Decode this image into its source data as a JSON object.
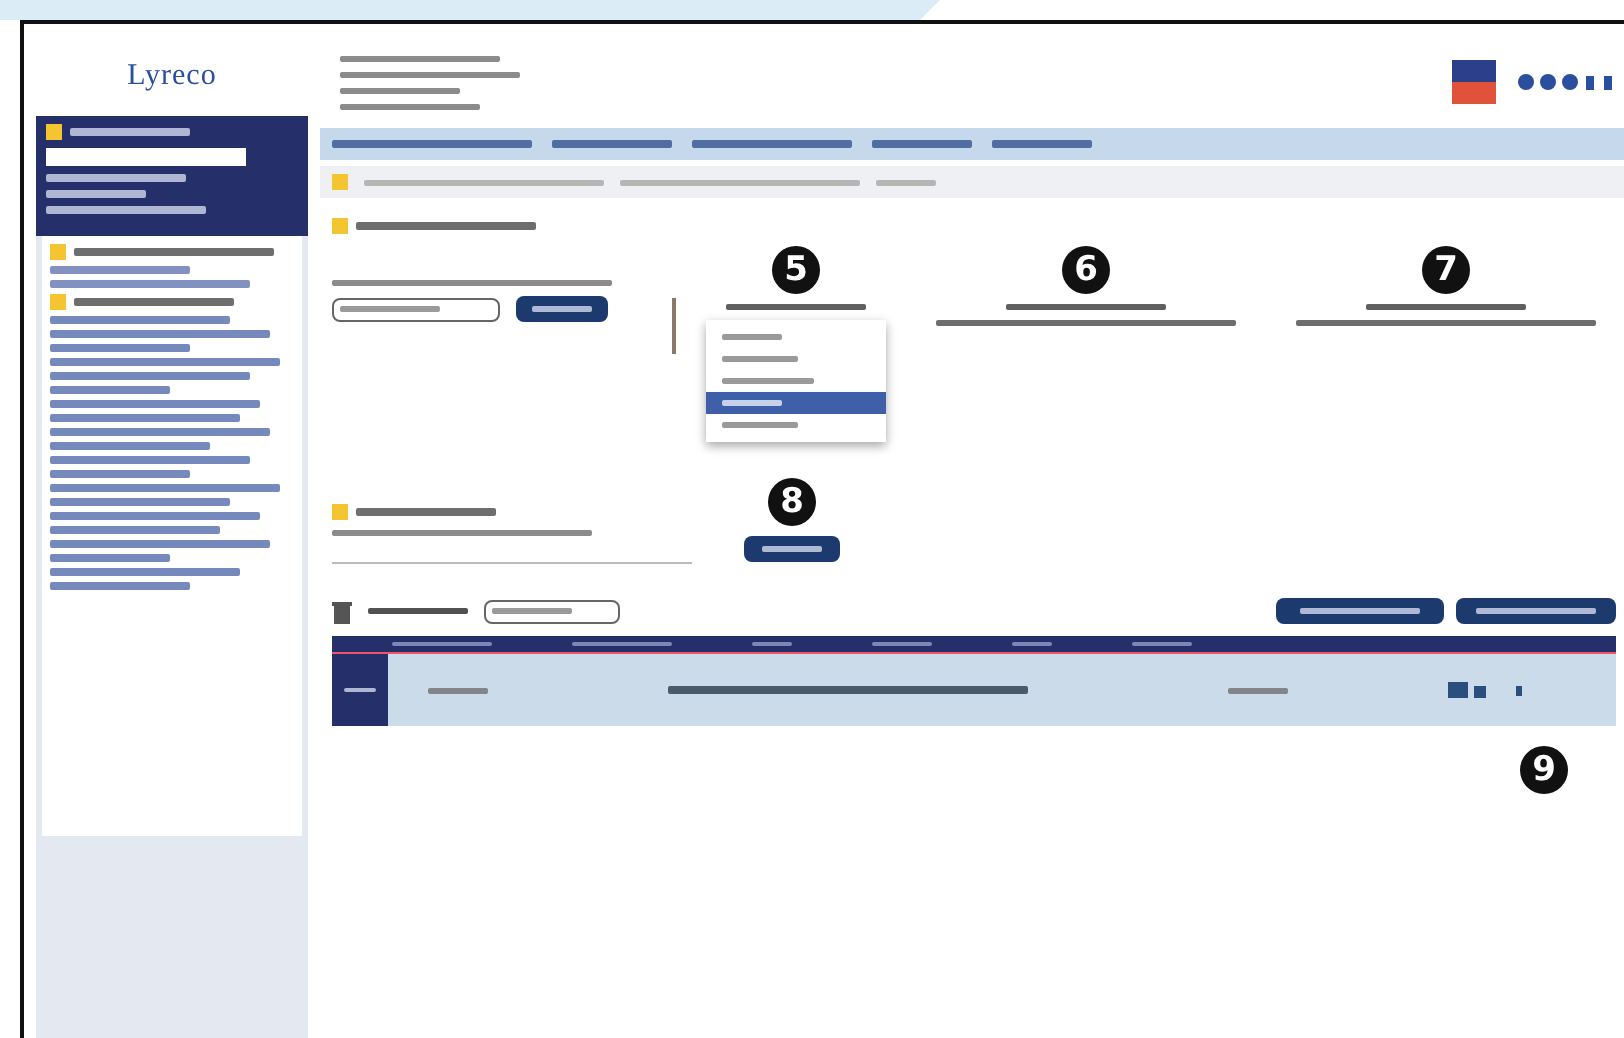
{
  "logo": {
    "text": "Lyreco"
  },
  "callouts": [
    "5",
    "6",
    "7",
    "8",
    "9"
  ],
  "status_dropdown": {
    "options": [
      {
        "selected": false
      },
      {
        "selected": false
      },
      {
        "selected": false
      },
      {
        "selected": true
      },
      {
        "selected": false
      }
    ]
  },
  "table": {
    "rows": [
      {
        "selected": true
      }
    ]
  }
}
